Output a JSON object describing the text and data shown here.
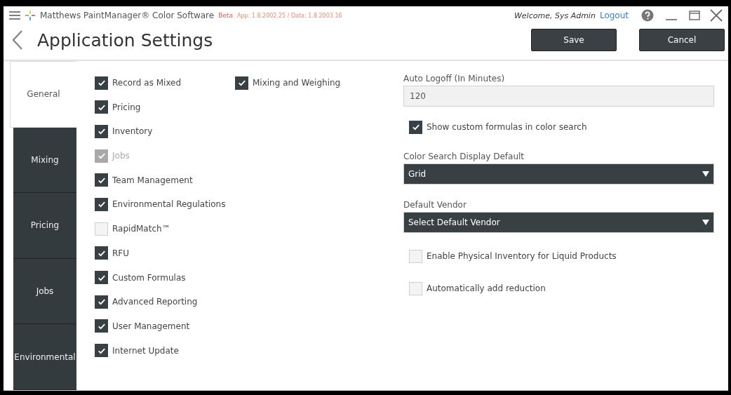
{
  "titlebar": {
    "app_name": "Matthews PaintManager® Color Software",
    "beta": "Beta",
    "version": "App: 1.8.2002.25 / Data: 1.8.2003.16",
    "welcome": "Welcome, Sys Admin",
    "logout": "Logout"
  },
  "header": {
    "title": "Application Settings",
    "buttons": [
      "Save",
      "Cancel"
    ]
  },
  "tabs": [
    {
      "label": "General",
      "selected": true
    },
    {
      "label": "Mixing",
      "selected": false
    },
    {
      "label": "Pricing",
      "selected": false
    },
    {
      "label": "Jobs",
      "selected": false
    },
    {
      "label": "Environmental",
      "selected": false
    }
  ],
  "column_1": [
    {
      "label": "Record as Mixed",
      "checked": true,
      "disabled": false
    },
    {
      "label": "Pricing",
      "checked": true,
      "disabled": false
    },
    {
      "label": "Inventory",
      "checked": true,
      "disabled": false
    },
    {
      "label": "Jobs",
      "checked": true,
      "disabled": true
    },
    {
      "label": "Team Management",
      "checked": true,
      "disabled": false
    },
    {
      "label": "Environmental Regulations",
      "checked": true,
      "disabled": false
    },
    {
      "label": "RapidMatch™",
      "checked": false,
      "disabled": false
    },
    {
      "label": "RFU",
      "checked": true,
      "disabled": false
    },
    {
      "label": "Custom Formulas",
      "checked": true,
      "disabled": false
    },
    {
      "label": "Advanced Reporting",
      "checked": true,
      "disabled": false
    },
    {
      "label": "User Management",
      "checked": true,
      "disabled": false
    },
    {
      "label": "Internet Update",
      "checked": true,
      "disabled": false
    }
  ],
  "column_2": [
    {
      "label": "Mixing and Weighing",
      "checked": true,
      "disabled": false
    }
  ],
  "right": [
    {
      "kind": "field",
      "label": "Auto Logoff (In Minutes)",
      "value": "120"
    },
    {
      "kind": "checkbox",
      "label": "Show custom formulas in color search",
      "checked": true,
      "disabled": false
    },
    {
      "kind": "select",
      "label": "Color Search Display Default",
      "value": "Grid"
    },
    {
      "kind": "select",
      "label": "Default Vendor",
      "value": "Select Default Vendor"
    },
    {
      "kind": "checkbox",
      "label": "Enable Physical Inventory for Liquid Products",
      "checked": false,
      "disabled": false
    },
    {
      "kind": "checkbox",
      "label": "Automatically add reduction",
      "checked": false,
      "disabled": false
    }
  ]
}
